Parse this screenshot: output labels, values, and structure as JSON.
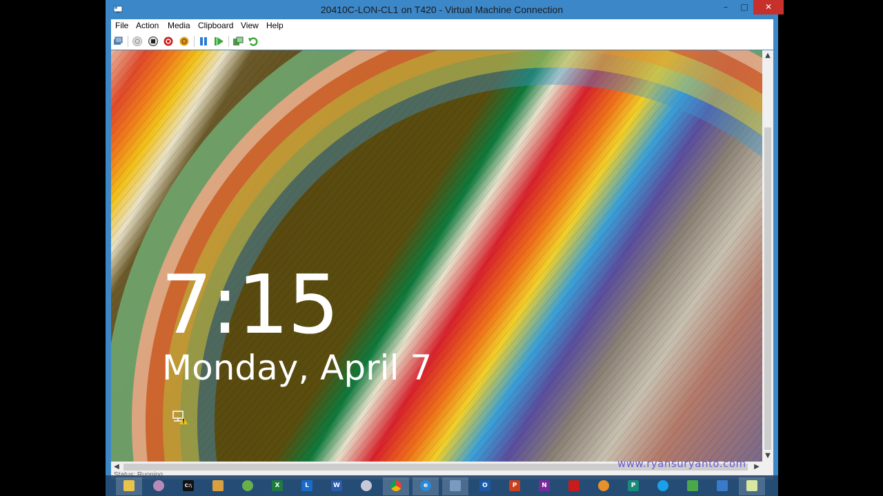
{
  "window": {
    "title": "20410C-LON-CL1 on T420 - Virtual Machine Connection",
    "minimize_glyph": "–",
    "maximize_glyph": "□",
    "close_glyph": "✕"
  },
  "menu": {
    "items": [
      {
        "label": "File"
      },
      {
        "label": "Action"
      },
      {
        "label": "Media"
      },
      {
        "label": "Clipboard"
      },
      {
        "label": "View"
      },
      {
        "label": "Help"
      }
    ]
  },
  "toolbar": {
    "buttons": [
      {
        "icon": "ctrl-alt-del-icon"
      },
      {
        "icon": "start-icon"
      },
      {
        "icon": "turn-off-icon"
      },
      {
        "icon": "shut-down-icon"
      },
      {
        "icon": "save-state-icon"
      },
      {
        "icon": "pause-icon"
      },
      {
        "icon": "resume-icon"
      },
      {
        "icon": "snapshot-icon"
      },
      {
        "icon": "revert-icon"
      }
    ]
  },
  "vm": {
    "clock": "7:15",
    "date": "Monday, April 7",
    "network_icon": "network-warning-icon"
  },
  "scrollbars": {
    "up": "▲",
    "down": "▼",
    "left": "◀",
    "right": "▶"
  },
  "status": {
    "text": "Status: Running"
  },
  "watermark": "www.ryansuryanto.com",
  "taskbar": {
    "items": [
      {
        "icon": "file-explorer-icon"
      },
      {
        "icon": "people-icon"
      },
      {
        "icon": "command-prompt-icon",
        "glyph": "C:\\"
      },
      {
        "icon": "archive-icon"
      },
      {
        "icon": "sync-icon"
      },
      {
        "icon": "excel-icon",
        "glyph": "X"
      },
      {
        "icon": "lync-icon",
        "glyph": "L"
      },
      {
        "icon": "word-icon",
        "glyph": "W"
      },
      {
        "icon": "disc-icon"
      },
      {
        "icon": "chrome-icon"
      },
      {
        "icon": "internet-explorer-icon",
        "glyph": "e"
      },
      {
        "icon": "hyper-v-manager-icon"
      },
      {
        "icon": "outlook-icon",
        "glyph": "O"
      },
      {
        "icon": "powerpoint-icon",
        "glyph": "P"
      },
      {
        "icon": "onenote-icon",
        "glyph": "N"
      },
      {
        "icon": "acrobat-icon"
      },
      {
        "icon": "media-player-icon"
      },
      {
        "icon": "publisher-icon",
        "glyph": "P"
      },
      {
        "icon": "skype-icon"
      },
      {
        "icon": "paint-icon"
      },
      {
        "icon": "remote-desktop-icon"
      },
      {
        "icon": "virtual-machine-connection-icon"
      }
    ]
  },
  "colors": {
    "titlebar": "#3c87c8",
    "close": "#c7302b",
    "watermark": "#6a5acd"
  }
}
